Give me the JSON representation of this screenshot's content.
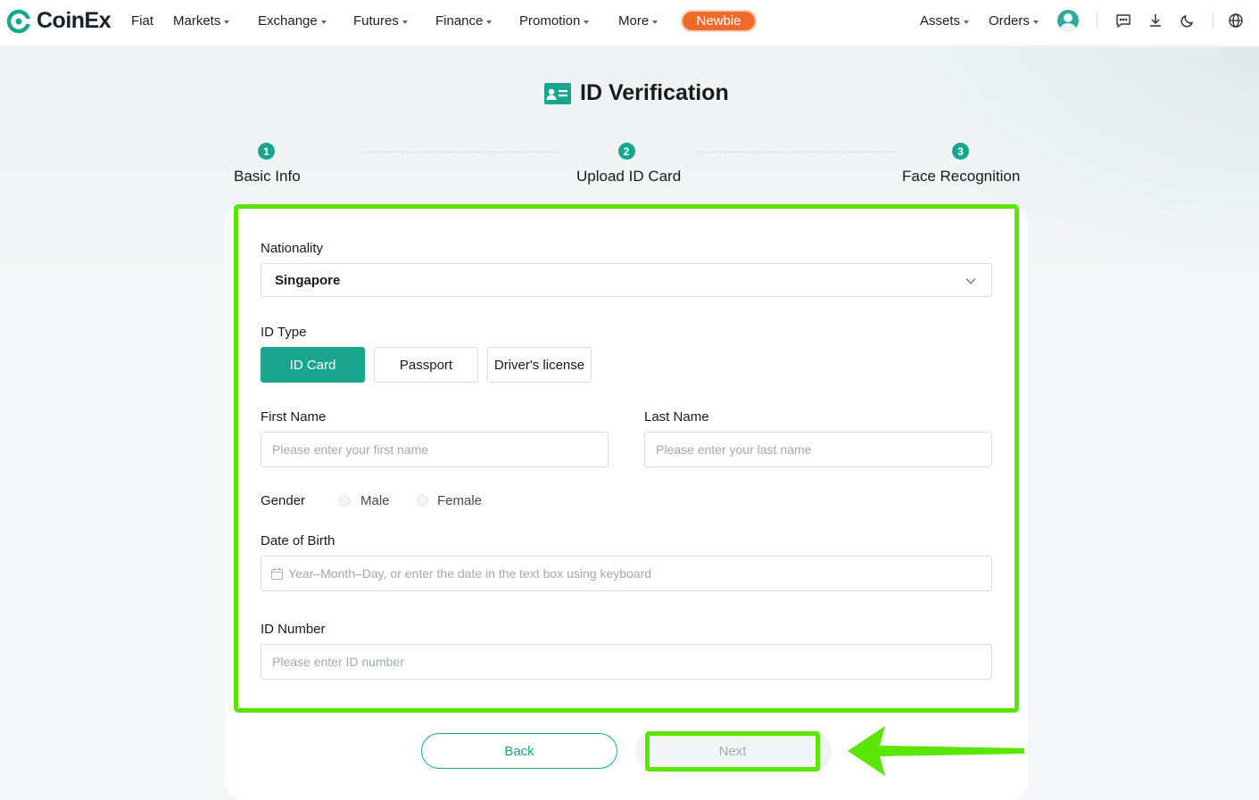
{
  "brand": {
    "name": "CoinEx",
    "color": "#1aa58e"
  },
  "nav": {
    "items": [
      {
        "label": "Fiat",
        "dropdown": false
      },
      {
        "label": "Markets",
        "dropdown": true
      },
      {
        "label": "Exchange",
        "dropdown": true
      },
      {
        "label": "Futures",
        "dropdown": true
      },
      {
        "label": "Finance",
        "dropdown": true
      },
      {
        "label": "Promotion",
        "dropdown": true
      },
      {
        "label": "More",
        "dropdown": true
      }
    ],
    "newbie_label": "Newbie",
    "assets_label": "Assets",
    "orders_label": "Orders",
    "icons": [
      "avatar",
      "message-icon",
      "download-icon",
      "dark-mode-icon",
      "globe-icon"
    ]
  },
  "page": {
    "title": "ID Verification",
    "steps": [
      {
        "number": "1",
        "label": "Basic Info"
      },
      {
        "number": "2",
        "label": "Upload ID Card"
      },
      {
        "number": "3",
        "label": "Face Recognition"
      }
    ]
  },
  "form": {
    "nationality_label": "Nationality",
    "nationality_value": "Singapore",
    "id_type_label": "ID Type",
    "id_types": [
      "ID Card",
      "Passport",
      "Driver's license"
    ],
    "id_type_selected": "ID Card",
    "first_name_label": "First Name",
    "first_name_placeholder": "Please enter your first name",
    "last_name_label": "Last Name",
    "last_name_placeholder": "Please enter your last name",
    "gender_label": "Gender",
    "gender_options": [
      "Male",
      "Female"
    ],
    "dob_label": "Date of Birth",
    "dob_placeholder": "Year–Month–Day, or enter the date in the text box using keyboard",
    "id_number_label": "ID Number",
    "id_number_placeholder": "Please enter ID number"
  },
  "actions": {
    "back_label": "Back",
    "next_label": "Next"
  },
  "annotation": {
    "highlight_color": "#5ae600"
  }
}
